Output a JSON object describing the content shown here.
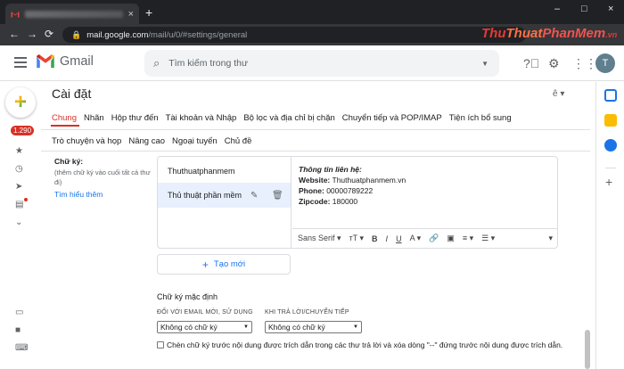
{
  "browser": {
    "url_host": "mail.google.com",
    "url_path": "/mail/u/0/#settings/general",
    "new_tab_glyph": "+",
    "tab_close_glyph": "×",
    "window_controls": [
      "–",
      "□",
      "×"
    ],
    "nav": [
      "←",
      "→",
      "C"
    ]
  },
  "watermark": {
    "part1": "Thu",
    "part2": "Thuat",
    "part3": "PhanMem",
    "suffix": ".vn"
  },
  "header": {
    "app_name": "Gmail",
    "search_placeholder": "Tìm kiếm trong thư",
    "avatar_letter": "T"
  },
  "left_rail": {
    "unread_badge": "1.290"
  },
  "settings": {
    "title": "Cài đặt",
    "tabs_row1": [
      "Chung",
      "Nhãn",
      "Hộp thư đến",
      "Tài khoản và Nhập",
      "Bộ lọc và địa chỉ bị chặn",
      "Chuyển tiếp và POP/IMAP",
      "Tiện ích bổ sung"
    ],
    "tabs_row2": [
      "Trò chuyện và họp",
      "Nâng cao",
      "Ngoại tuyến",
      "Chủ đề"
    ],
    "active_tab": "Chung"
  },
  "signature": {
    "label": "Chữ ký:",
    "help": "(thêm chữ ký vào cuối tất cả thư đi)",
    "learn_more": "Tìm hiểu thêm",
    "items": [
      "Thuthuatphanmem",
      "Thủ thuật phần mềm"
    ],
    "selected_index": 1,
    "editor": {
      "heading": "Thông tin liên hệ:",
      "lines": [
        {
          "key": "Website:",
          "value": "Thuthuatphanmem.vn"
        },
        {
          "key": "Phone:",
          "value": "00000789222"
        },
        {
          "key": "Zipcode:",
          "value": "180000"
        }
      ]
    },
    "toolbar": {
      "font": "Sans Serif",
      "items": [
        "TT",
        "B",
        "I",
        "U",
        "A",
        "link",
        "image",
        "align",
        "list"
      ]
    },
    "create_button": "Tạo mới"
  },
  "defaults": {
    "title": "Chữ ký mặc định",
    "new_label": "ĐỐI VỚI EMAIL MỚI, SỬ DỤNG",
    "reply_label": "KHI TRẢ LỜI/CHUYỂN TIẾP",
    "new_value": "Không có chữ ký",
    "reply_value": "Không có chữ ký",
    "checkbox_text": "Chèn chữ ký trước nội dung được trích dẫn trong các thư trả lời và xóa dòng \"--\" đứng trước nội dung được trích dẫn."
  },
  "colors": {
    "accent_red": "#d93025",
    "link_blue": "#1a73e8",
    "chrome_dark": "#202124"
  }
}
